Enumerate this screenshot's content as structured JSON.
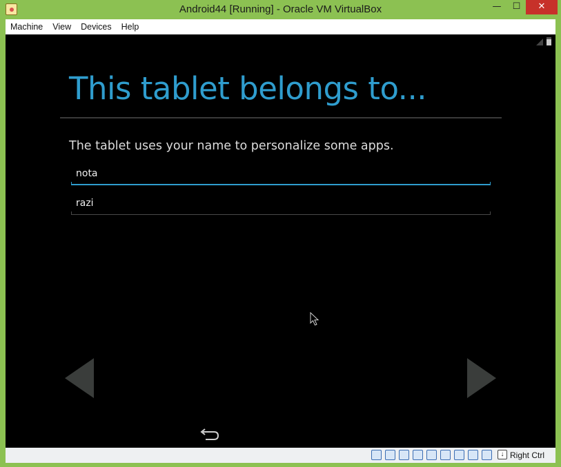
{
  "window": {
    "title": "Android44 [Running] - Oracle VM VirtualBox",
    "controls": {
      "minimize": "—",
      "maximize": "☐",
      "close": "✕"
    }
  },
  "menubar": {
    "items": [
      "Machine",
      "View",
      "Devices",
      "Help"
    ]
  },
  "android": {
    "heading": "This tablet belongs to...",
    "subtitle": "The tablet uses your name to personalize some apps.",
    "first_name_value": "nota",
    "last_name_value": "razi",
    "accent_color": "#2f9dce"
  },
  "statusbar": {
    "icons": [
      "storage-icon",
      "optical-drive-icon",
      "usb-icon",
      "shared-folders-icon",
      "display-icon",
      "video-capture-icon",
      "network-icon",
      "cpu-icon",
      "mouse-integration-icon"
    ],
    "host_key_label": "Right Ctrl"
  }
}
